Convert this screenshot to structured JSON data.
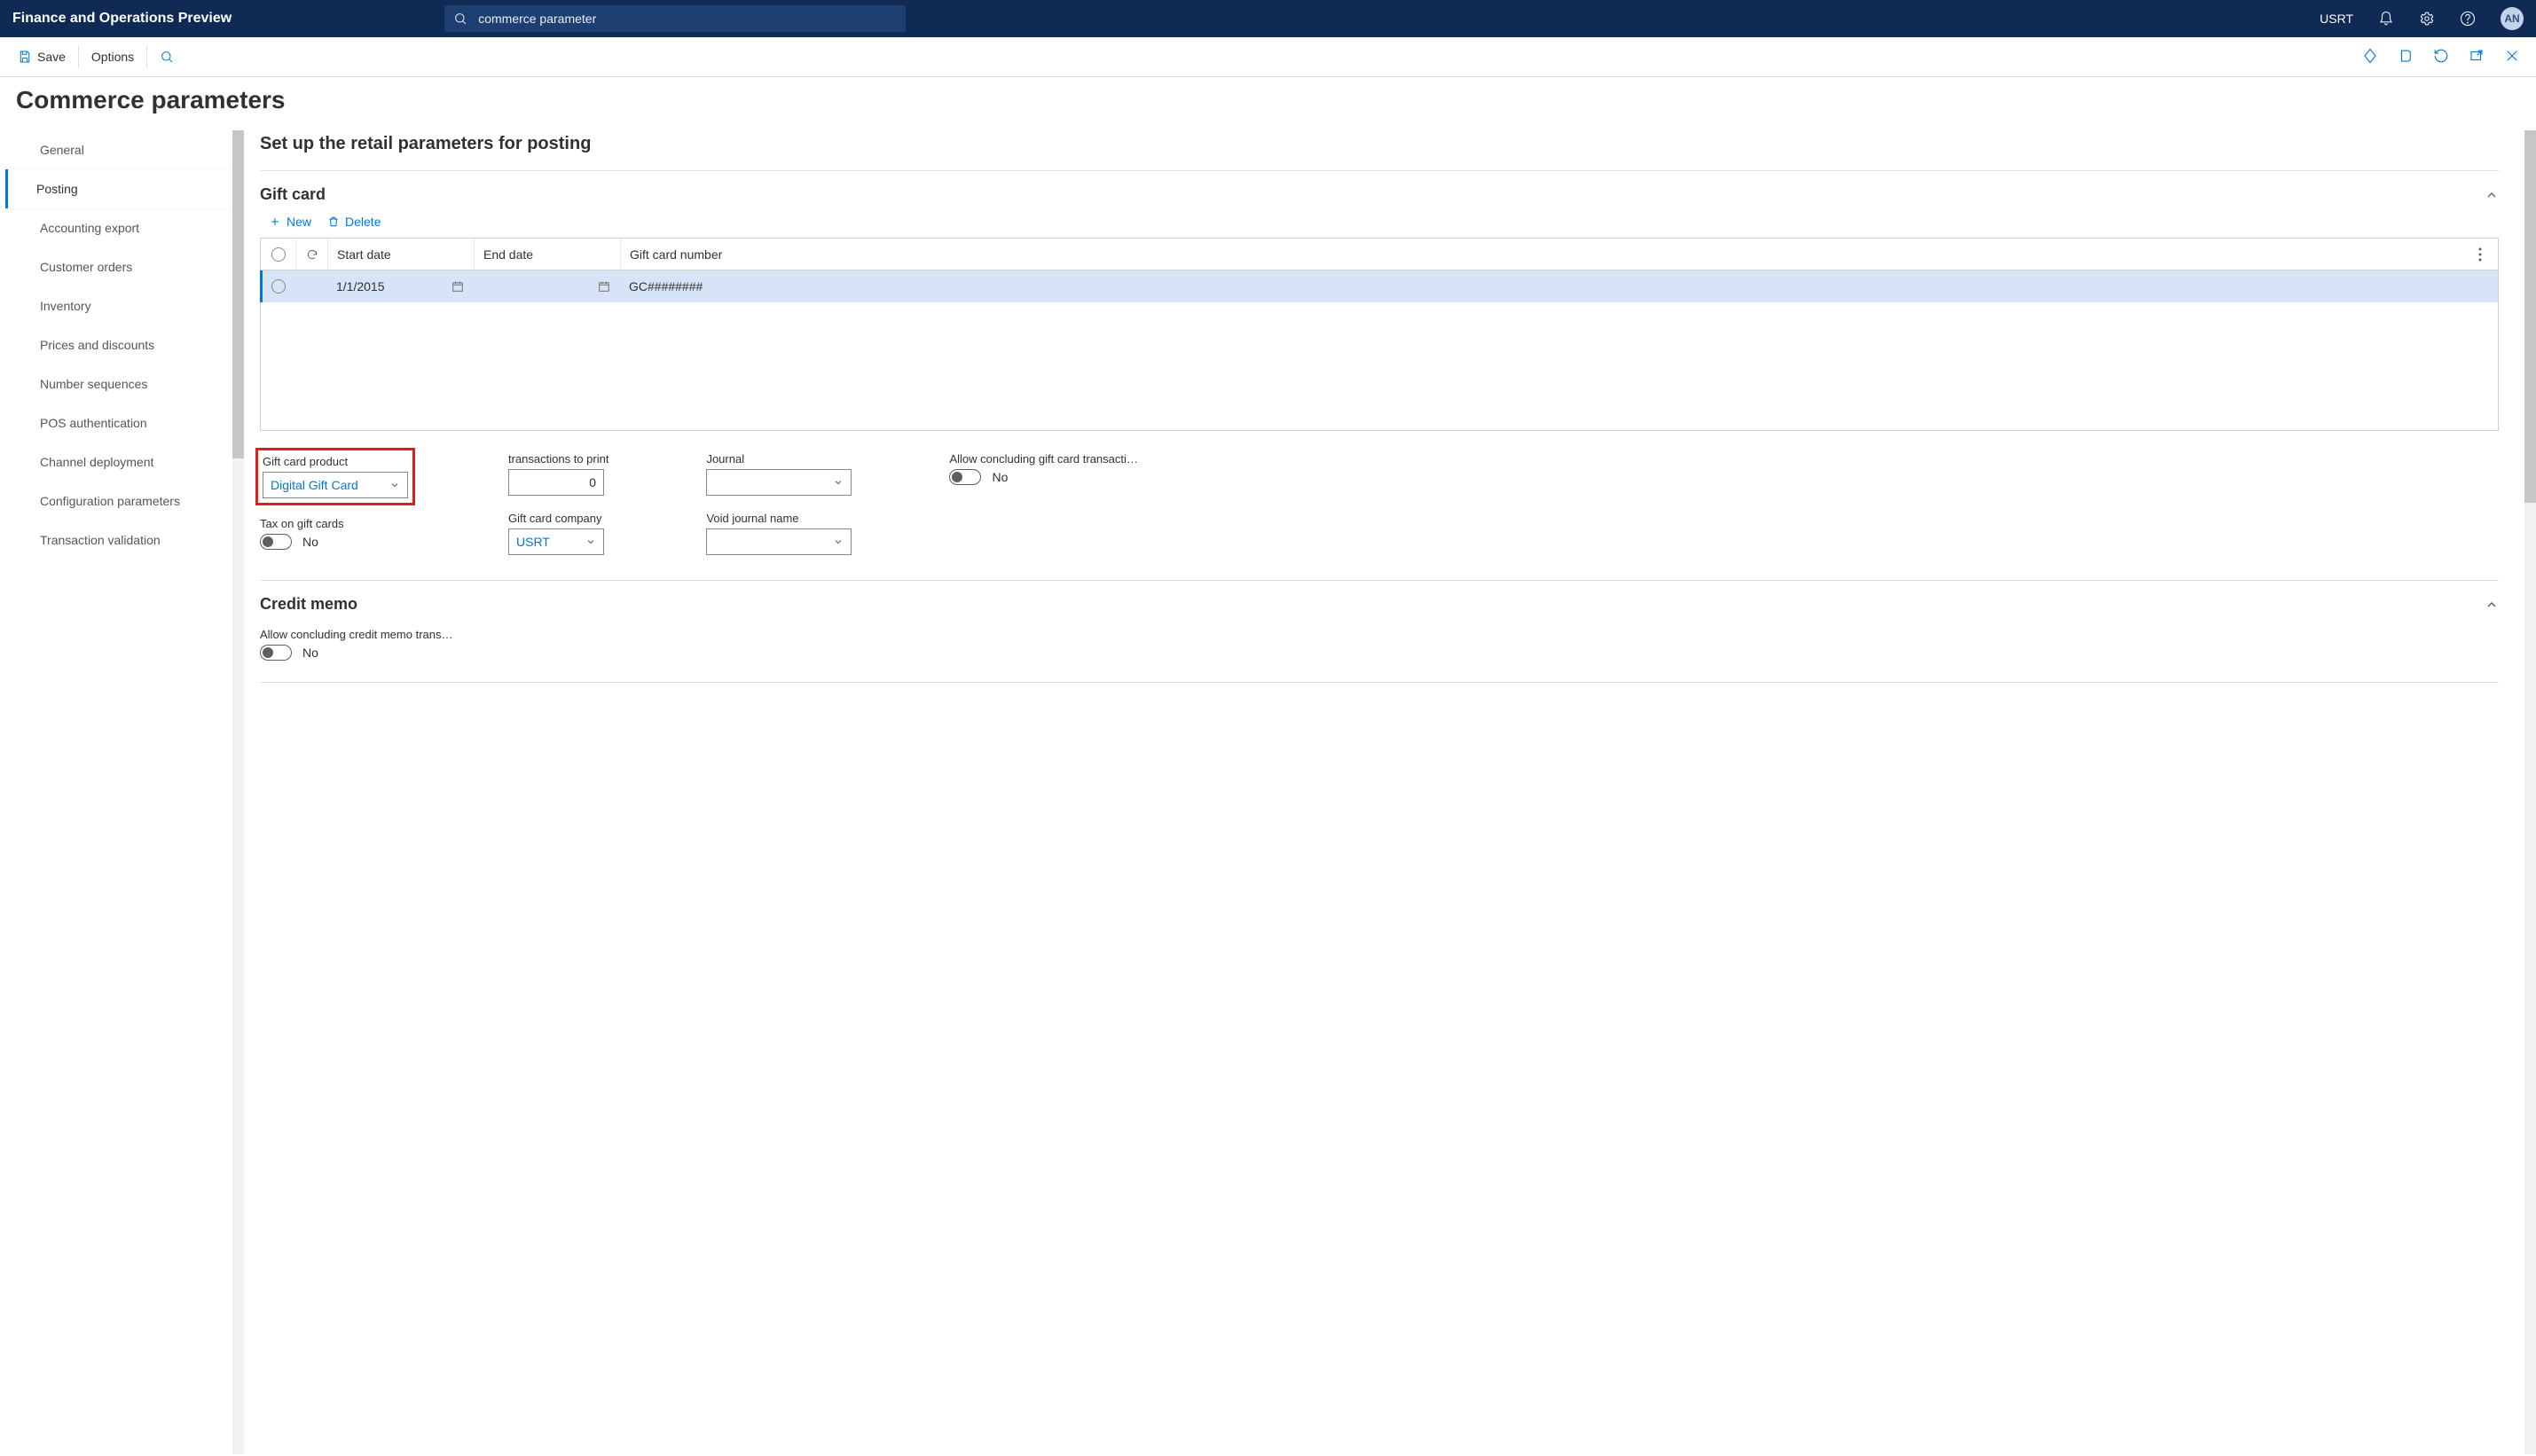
{
  "app_title": "Finance and Operations Preview",
  "search_value": "commerce parameter",
  "topbar": {
    "entity": "USRT",
    "avatar": "AN"
  },
  "actionbar": {
    "save": "Save",
    "options": "Options"
  },
  "page_title": "Commerce parameters",
  "sidebar": {
    "items": [
      {
        "label": "General"
      },
      {
        "label": "Posting"
      },
      {
        "label": "Accounting export"
      },
      {
        "label": "Customer orders"
      },
      {
        "label": "Inventory"
      },
      {
        "label": "Prices and discounts"
      },
      {
        "label": "Number sequences"
      },
      {
        "label": "POS authentication"
      },
      {
        "label": "Channel deployment"
      },
      {
        "label": "Configuration parameters"
      },
      {
        "label": "Transaction validation"
      }
    ],
    "active_index": 1
  },
  "content": {
    "heading": "Set up the retail parameters for posting",
    "giftcard": {
      "title": "Gift card",
      "toolbar": {
        "new": "New",
        "delete": "Delete"
      },
      "columns": {
        "start": "Start date",
        "end": "End date",
        "num": "Gift card number"
      },
      "rows": [
        {
          "start": "1/1/2015",
          "end": "",
          "num": "GC########"
        }
      ],
      "fields": {
        "gift_card_product": {
          "label": "Gift card product",
          "value": "Digital Gift Card"
        },
        "tax_on_gift_cards": {
          "label": "Tax on gift cards",
          "value": "No"
        },
        "transactions_to_print": {
          "label": "transactions to print",
          "value": "0"
        },
        "gift_card_company": {
          "label": "Gift card company",
          "value": "USRT"
        },
        "journal": {
          "label": "Journal",
          "value": ""
        },
        "void_journal_name": {
          "label": "Void journal name",
          "value": ""
        },
        "allow_concluding_gc": {
          "label": "Allow concluding gift card transacti…",
          "value": "No"
        }
      }
    },
    "credit_memo": {
      "title": "Credit memo",
      "allow_concluding": {
        "label": "Allow concluding credit memo trans…",
        "value": "No"
      }
    }
  }
}
